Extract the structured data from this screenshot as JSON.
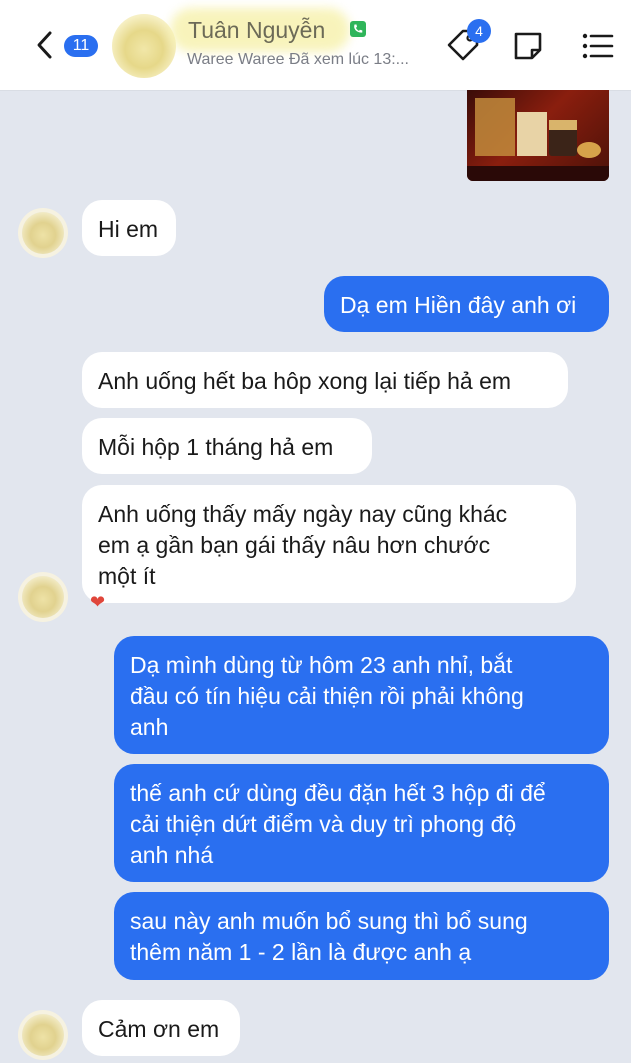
{
  "header": {
    "unread_count": "11",
    "title": "Tuân Nguyễn",
    "subtitle": "Waree Waree Đã xem lúc 13:...",
    "tag_badge": "4",
    "accent": "#2a6ff0"
  },
  "icons": {
    "back": "chevron-left-icon",
    "phone": "phone-icon",
    "tag": "tag-icon",
    "note": "note-icon",
    "menu": "menu-icon"
  },
  "messages": [
    {
      "side": "in",
      "text": "Hi em"
    },
    {
      "side": "out",
      "text": "Dạ em Hiền đây anh ơi"
    },
    {
      "side": "in",
      "text": "Anh uống hết ba hôp xong lại tiếp hả em"
    },
    {
      "side": "in",
      "text": "Mỗi hộp 1 tháng hả em"
    },
    {
      "side": "in",
      "lines": [
        "Anh uống thấy mấy ngày nay cũng khác",
        "em ạ gần bạn gái thấy nâu hơn chước",
        "một ít"
      ],
      "reaction": "❤"
    },
    {
      "side": "out",
      "lines": [
        "Dạ mình dùng từ hôm 23 anh nhỉ, bắt",
        "đầu có tín hiệu cải thiện rồi phải không",
        "anh"
      ]
    },
    {
      "side": "out",
      "lines": [
        "thế anh cứ dùng đều đặn hết 3 hộp đi để",
        "cải thiện dứt điểm và duy trì phong độ",
        "anh nhá"
      ]
    },
    {
      "side": "out",
      "lines": [
        "sau này anh muốn bổ sung thì bổ sung",
        "thêm năm 1 - 2 lần là được anh ạ"
      ]
    },
    {
      "side": "in",
      "text": "Cảm ơn em"
    }
  ]
}
